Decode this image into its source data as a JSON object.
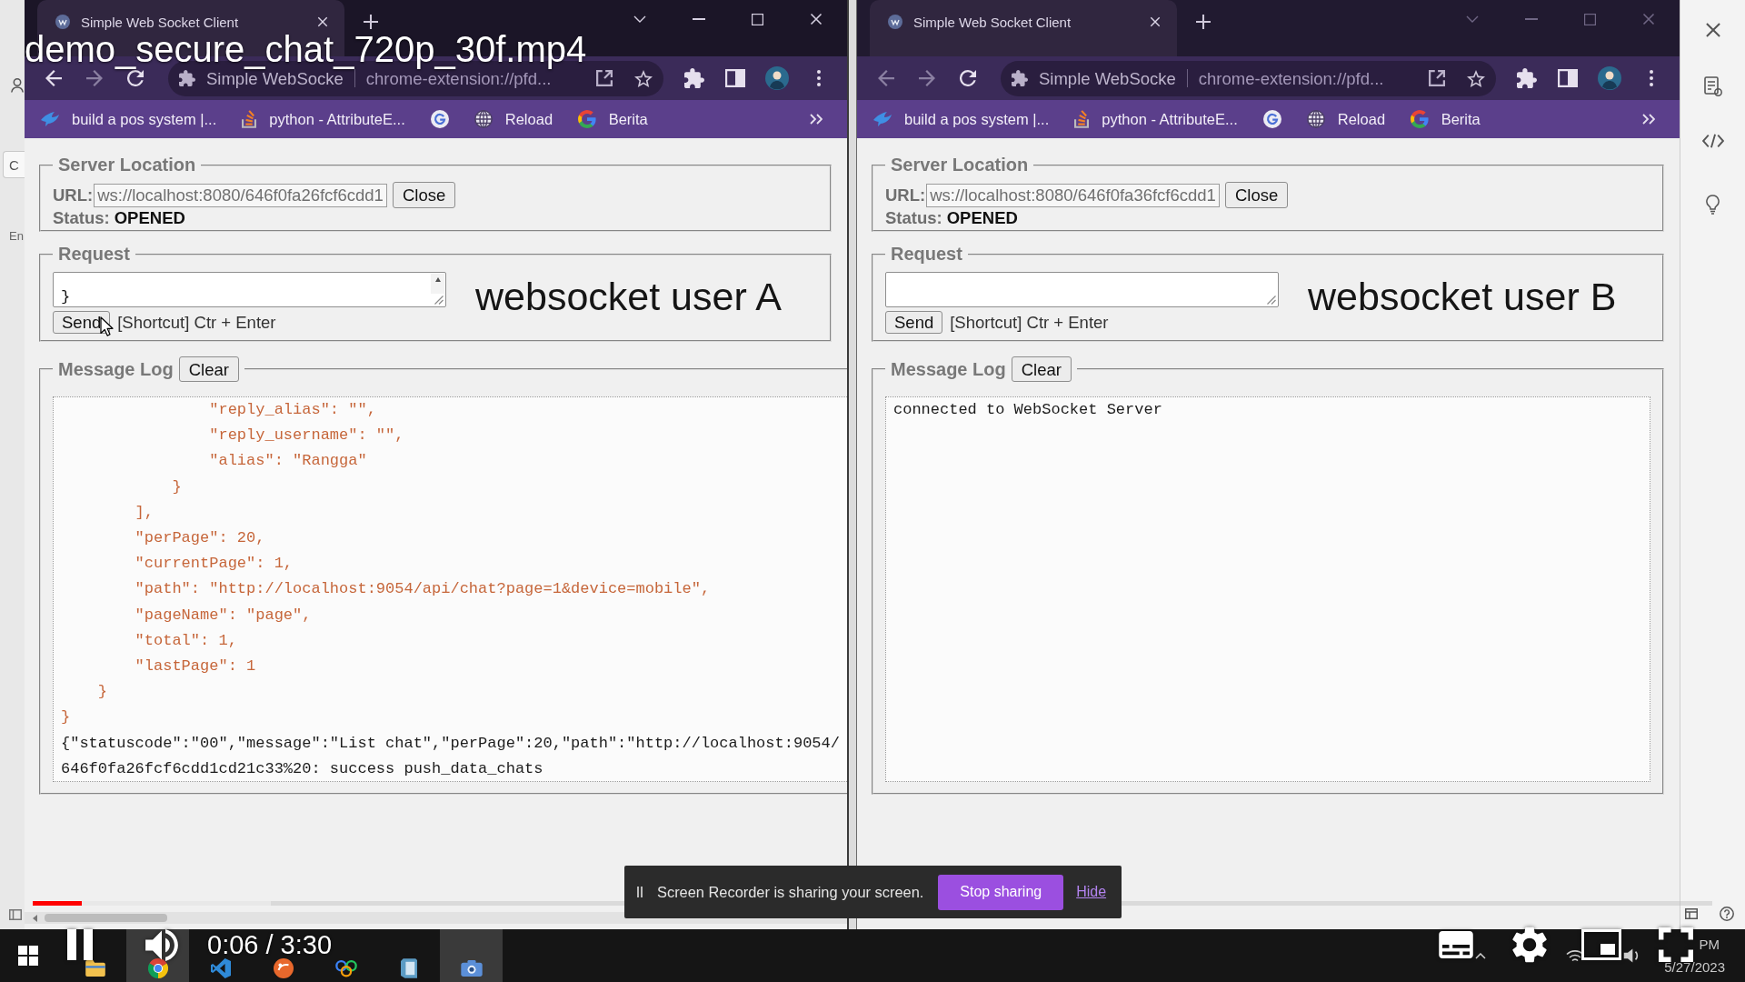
{
  "video": {
    "title": "demo_secure_chat_720p_30f.mp4",
    "playing": true,
    "progress": {
      "level": 0.029,
      "buffered": {
        "level": 0.142
      }
    },
    "time": "0:06 / 3:30"
  },
  "left_edge": {
    "button": "C",
    "label": "En"
  },
  "windows": [
    {
      "focused": true,
      "tabs": [
        {
          "title": "Simple Web Socket Client",
          "selected": true
        }
      ],
      "back": {
        "disabled": false
      },
      "forward": {
        "disabled": true
      },
      "omnibox": {
        "site": "Simple WebSocke",
        "url": "chrome-extension://pfd..."
      },
      "bookmarks": [
        {
          "kind": "link",
          "label": "build a pos system |..."
        },
        {
          "kind": "link",
          "label": "python - AttributeE..."
        },
        {
          "kind": "icon"
        },
        {
          "kind": "link",
          "label": "Reload"
        },
        {
          "kind": "link",
          "label": "Berita"
        }
      ],
      "caption": "websocket user A",
      "page": {
        "h_scrollbar": true,
        "server": {
          "legend": "Server Location",
          "url_label": "URL:",
          "url": "ws://localhost:8080/646f0fa26fcf6cdd1",
          "close": "Close",
          "status_label": "Status:",
          "status": "OPENED"
        },
        "request": {
          "legend": "Request",
          "value": "}",
          "scrollbar": true,
          "send": "Send",
          "hint": "[Shortcut] Ctr + Enter",
          "mouse_pointer": true
        },
        "log": {
          "legend": "Message Log",
          "clear": "Clear",
          "lines": [
            {
              "kind": "json",
              "text": "                \"reply_alias\": \"\","
            },
            {
              "kind": "json",
              "text": "                \"reply_username\": \"\","
            },
            {
              "kind": "json",
              "text": "                \"alias\": \"Rangga\""
            },
            {
              "kind": "json",
              "text": "            }"
            },
            {
              "kind": "json",
              "text": "        ],"
            },
            {
              "kind": "json",
              "text": "        \"perPage\": 20,"
            },
            {
              "kind": "json",
              "text": "        \"currentPage\": 1,"
            },
            {
              "kind": "json",
              "text": "        \"path\": \"http://localhost:9054/api/chat?page=1&device=mobile\","
            },
            {
              "kind": "json",
              "text": "        \"pageName\": \"page\","
            },
            {
              "kind": "json",
              "text": "        \"total\": 1,"
            },
            {
              "kind": "json",
              "text": "        \"lastPage\": 1"
            },
            {
              "kind": "json",
              "text": "    }"
            },
            {
              "kind": "json",
              "text": "}"
            },
            {
              "kind": "text",
              "text": "{\"statuscode\":\"00\",\"message\":\"List chat\",\"perPage\":20,\"path\":\"http://localhost:9054/"
            },
            {
              "kind": "text",
              "text": "646f0fa26fcf6cdd1cd21c33%20: success push_data_chats"
            }
          ]
        }
      }
    },
    {
      "focused": false,
      "tabs": [
        {
          "title": "Simple Web Socket Client",
          "selected": true
        }
      ],
      "back": {
        "disabled": true
      },
      "forward": {
        "disabled": true
      },
      "omnibox": {
        "site": "Simple WebSocke",
        "url": "chrome-extension://pfd..."
      },
      "bookmarks": [
        {
          "kind": "link",
          "label": "build a pos system |..."
        },
        {
          "kind": "link",
          "label": "python - AttributeE..."
        },
        {
          "kind": "icon"
        },
        {
          "kind": "link",
          "label": "Reload"
        },
        {
          "kind": "link",
          "label": "Berita"
        }
      ],
      "caption": "websocket user B",
      "page": {
        "h_scrollbar": false,
        "server": {
          "legend": "Server Location",
          "url_label": "URL:",
          "url": "ws://localhost:8080/646f0fa36fcf6cdd1",
          "close": "Close",
          "status_label": "Status:",
          "status": "OPENED"
        },
        "request": {
          "legend": "Request",
          "scrollbar": false,
          "send": "Send",
          "hint": "[Shortcut] Ctr + Enter",
          "mouse_pointer": false
        },
        "log": {
          "legend": "Message Log",
          "clear": "Clear",
          "lines": [
            {
              "kind": "text",
              "text": "connected to WebSocket Server"
            }
          ]
        }
      }
    }
  ],
  "screen_share": {
    "message": "Screen Recorder is sharing your screen.",
    "stop": "Stop sharing",
    "hide": "Hide"
  },
  "taskbar": {
    "apps": [
      {
        "active": false
      },
      {
        "active": true
      },
      {
        "active": false
      },
      {
        "active": false
      },
      {
        "active": false
      },
      {
        "active": false
      },
      {
        "active": true
      }
    ],
    "time": "PM",
    "date": "5/27/2023"
  }
}
